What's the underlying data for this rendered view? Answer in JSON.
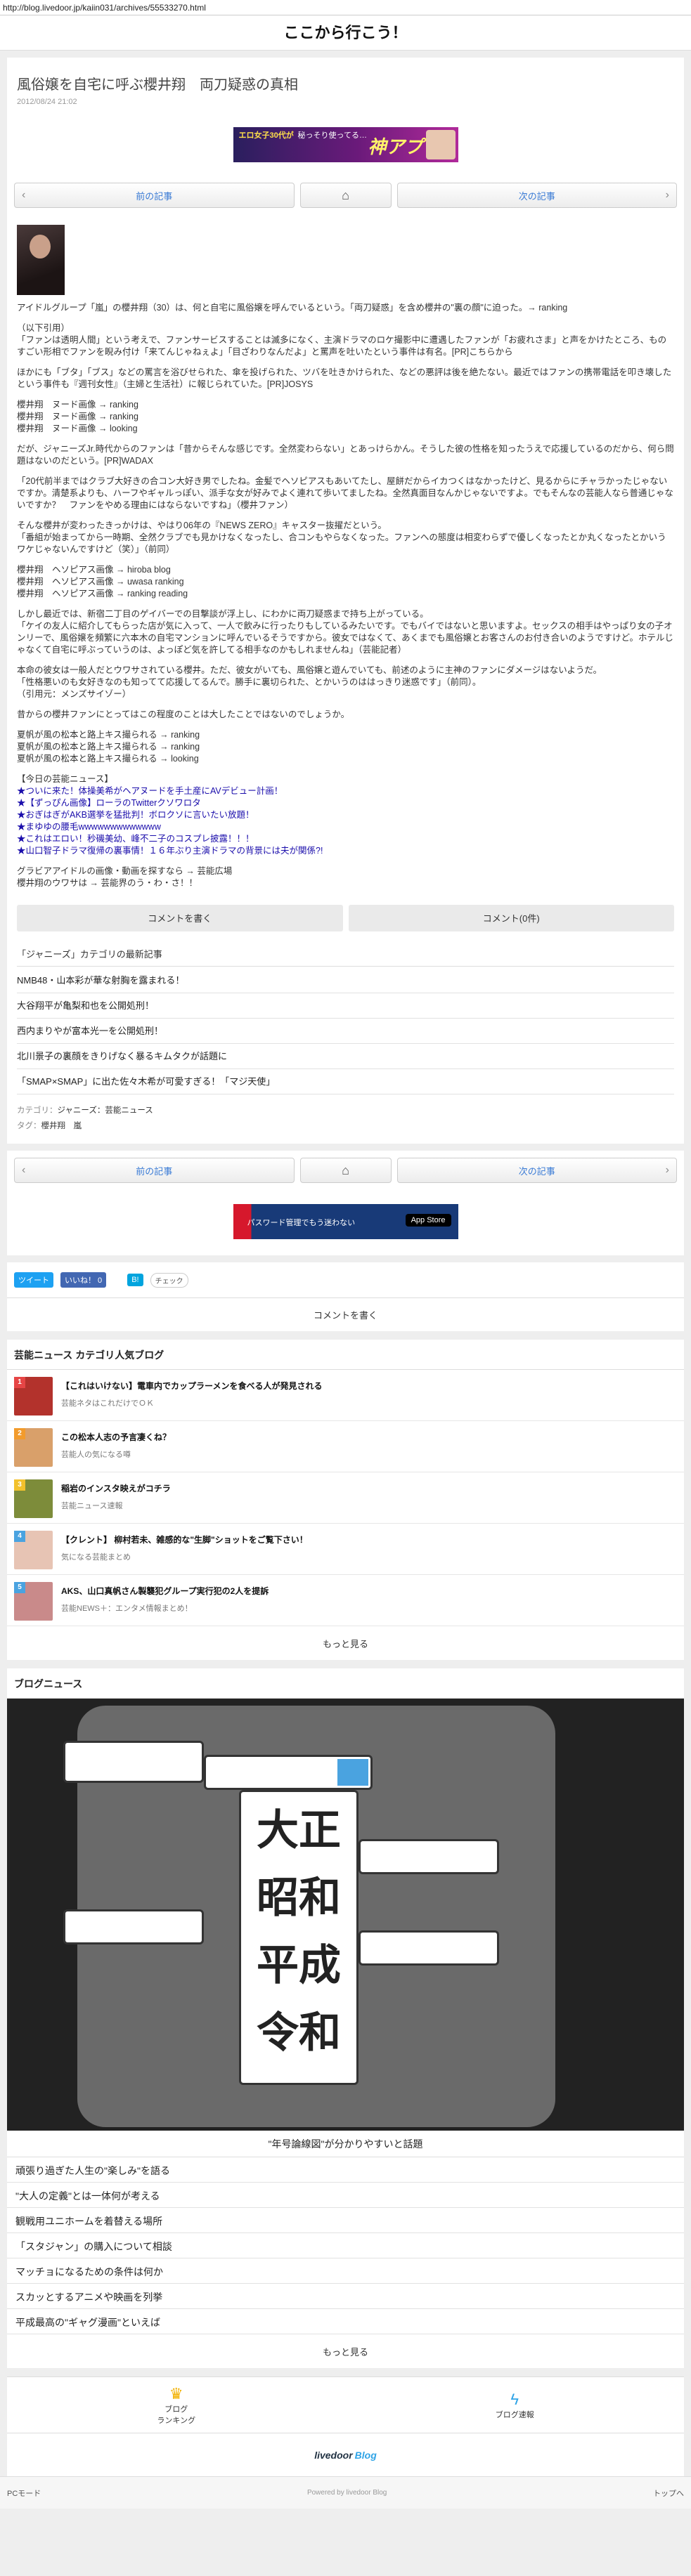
{
  "url": "http://blog.livedoor.jp/kaiin031/archives/55533270.html",
  "site_title": "ここから行こう！",
  "article": {
    "title": "風俗嬢を自宅に呼ぶ櫻井翔　両刀疑惑の真相",
    "date": "2012/08/24 21:02"
  },
  "top_banner": {
    "line1": "エロ女子30代が",
    "line2": "秘っそり使ってる…",
    "brand": "神アプリ"
  },
  "pager": {
    "prev": "前の記事",
    "next": "次の記事"
  },
  "body": {
    "p1": "アイドルグループ「嵐」の櫻井翔（30）は、何と自宅に風俗嬢を呼んでいるという。「両刀疑惑」を含め櫻井の\"裏の顔\"に迫った。→ ranking",
    "p2a": "（以下引用）",
    "p2b": "「ファンは透明人間」という考えで、ファンサービスすることは滅多になく、主演ドラマのロケ撮影中に遭遇したファンが「お疲れさま」と声をかけたところ、ものすごい形相でファンを睨み付け「来てんじゃねぇよ」「目ざわりなんだよ」と罵声を吐いたという事件は有名。[PR]こちらから",
    "p3": "ほかにも「ブタ」「ブス」などの罵言を浴びせられた、傘を投げられた、ツバを吐きかけられた、などの悪評は後を絶たない。最近ではファンの携帯電話を叩き壊したという事件も『週刊女性』（主婦と生活社）に報じられていた。[PR]JOSYS",
    "p4a": "櫻井翔　ヌード画像 → ranking",
    "p4b": "櫻井翔　ヌード画像 → ranking",
    "p4c": "櫻井翔　ヌード画像 → looking",
    "p5": "だが、ジャニーズJr.時代からのファンは「昔からそんな感じです。全然変わらない」とあっけらかん。そうした彼の性格を知ったうえで応援しているのだから、何ら問題はないのだという。[PR]WADAX",
    "p6a": "「20代前半まではクラブ大好きの合コン大好き男でしたね。金髪でヘソピアスもあいてたし、屋餅だからイカつくはなかったけど、見るからにチャラかったじゃないですか。清楚系よりも、ハーフやギャルっぽい、派手な女が好みでよく連れて歩いてましたね。全然真面目なんかじゃないですよ。でもそんなの芸能人なら普通じゃないですか？　ファンをやめる理由にはならないですね」（櫻井ファン）",
    "p7a": "そんな櫻井が変わったきっかけは、やはり06年の『NEWS ZERO』キャスター抜擢だという。",
    "p7b": "「番組が始まってから一時期、全然クラブでも見かけなくなったし、合コンもやらなくなった。ファンへの態度は相変わらずで優しくなったとか丸くなったとかいうワケじゃないんですけど（笑）」（前同）",
    "p8a": "櫻井翔　ヘソピアス画像 → hiroba blog",
    "p8b": "櫻井翔　ヘソピアス画像 → uwasa ranking",
    "p8c": "櫻井翔　ヘソピアス画像 → ranking reading",
    "p9a": "しかし最近では、新宿二丁目のゲイバーでの目撃談が浮上し、にわかに両刀疑惑まで持ち上がっている。",
    "p9b": "「ケイの友人に紹介してもらった店が気に入って、一人で飲みに行ったりもしているみたいです。でもバイではないと思いますよ。セックスの相手はやっぱり女の子オンリーで、風俗嬢を頻繁に六本木の自宅マンションに呼んでいるそうですから。彼女ではなくて、あくまでも風俗嬢とお客さんのお付き合いのようですけど。ホテルじゃなくて自宅に呼ぶっていうのは、よっぽど気を許してる相手なのかもしれませんね」（芸能記者）",
    "p10a": "本命の彼女は一般人だとウワサされている櫻井。ただ、彼女がいても、風俗嬢と遊んでいても、前述のように主神のファンにダメージはないようだ。",
    "p10b": "「性格悪いのも女好きなのも知ってて応援してるんで。勝手に裏切られた、とかいうのははっきり迷惑です」（前同）。",
    "p10c": "（引用元：メンズサイゾー）",
    "p11": "昔からの櫻井ファンにとってはこの程度のことは大したことではないのでしょうか。",
    "p12a": "夏帆が風の松本と路上キス撮られる → ranking",
    "p12b": "夏帆が風の松本と路上キス撮られる → ranking",
    "p12c": "夏帆が風の松本と路上キス撮られる → looking",
    "news_head": "【今日の芸能ニュース】",
    "news": [
      "★ついに来た！体操美希がヘアヌードを手土産にAVデビュー計画！",
      "★【ずっぴん画像】ローラのTwitterクソワロタ",
      "★おぎはぎがAKB選挙を猛批判！ボロクソに言いたい放題！",
      "★まゆゆの腰毛wwwwwwwwwwwww",
      "★これはエロい！秒磯美幼、峰不二子のコスプレ披露！！！",
      "★山口智子ドラマ復帰の裏事情！１６年ぶり主演ドラマの背景には夫が関係?!"
    ],
    "p13a": "グラビアアイドルの画像・動画を探すなら → 芸能広場",
    "p13b": "櫻井翔のウワサは → 芸能界のう・わ・さ！！"
  },
  "comment_buttons": {
    "write": "コメントを書く",
    "count": "コメント(0件)"
  },
  "category": {
    "title": "「ジャニーズ」カテゴリの最新記事",
    "items": [
      "NMB48・山本彩が華な射胸を露まれる！",
      "大谷翔平が亀梨和也を公開処刑！",
      "西内まりやが富本光一を公開処刑！",
      "北川景子の裏顔をきりげなく暴るキムタクが話題に",
      "「SMAP×SMAP」に出た佐々木希が可愛すぎる！「マジ天使」"
    ],
    "meta_category_label": "カテゴリ：",
    "meta_category": "ジャニーズ：芸能ニュース",
    "meta_tag_label": "タグ：",
    "meta_tags": "櫻井翔　嵐"
  },
  "app_banner": {
    "text": "パスワード管理でもう迷わない",
    "store": "App Store"
  },
  "share": {
    "tweet": "ツイート",
    "like": "いいね！ 0",
    "hatena": "B!",
    "pocket": "チェック"
  },
  "write_comment": "コメントを書く",
  "popular": {
    "title": "芸能ニュース カテゴリ人気ブログ",
    "items": [
      {
        "rank": "1",
        "title": "【これはいけない】電車内でカップラーメンを食べる人が発見される",
        "blog": "芸能ネタはこれだけでＯＫ",
        "color": "#b3322c",
        "rank_color": "#e64545"
      },
      {
        "rank": "2",
        "title": "この松本人志の予言凄くね？",
        "blog": "芸能人の気になる噂",
        "color": "#d9a06a",
        "rank_color": "#f29b2c"
      },
      {
        "rank": "3",
        "title": "稲岩のインスタ映えがコチラ",
        "blog": "芸能ニュース速報",
        "color": "#7d8c3a",
        "rank_color": "#f2c12c"
      },
      {
        "rank": "4",
        "title": "【クレント】 柳村若未、雑感的な\"生脚\"ショットをご覧下さい！",
        "blog": "気になる芸能まとめ",
        "color": "#e7c4b4",
        "rank_color": "#4aa3e0"
      },
      {
        "rank": "5",
        "title": "AKS、山口真帆さん製襲犯グループ実行犯の2人を提訴",
        "blog": "芸能NEWS＋：エンタメ情報まとめ！",
        "color": "#c98a8a",
        "rank_color": "#4aa3e0"
      }
    ],
    "more": "もっと見る"
  },
  "blog_news": {
    "title": "ブログニュース",
    "feature_eras": [
      "大正",
      "昭和",
      "平成",
      "令和"
    ],
    "feature_caption": "\"年号論線図\"が分かりやすいと話題",
    "items": [
      "頑張り過ぎた人生の\"楽しみ\"を語る",
      "\"大人の定義\"とは一体何が考える",
      "観戦用ユニホームを着替える場所",
      "「スタジャン」の購入について相談",
      "マッチョになるための条件は何か",
      "スカッとするアニメや映画を列挙",
      "平成最高の\"ギャグ漫画\"といえば"
    ],
    "more": "もっと見る"
  },
  "footer": {
    "ranking": "ブログ\nランキング",
    "ranking_l1": "ブログ",
    "ranking_l2": "ランキング",
    "breaking": "ブログ速報",
    "logo_main": "livedoor",
    "logo_blog": "Blog",
    "pc_mode": "PCモード",
    "powered": "Powered by livedoor Blog",
    "top": "トップへ"
  }
}
